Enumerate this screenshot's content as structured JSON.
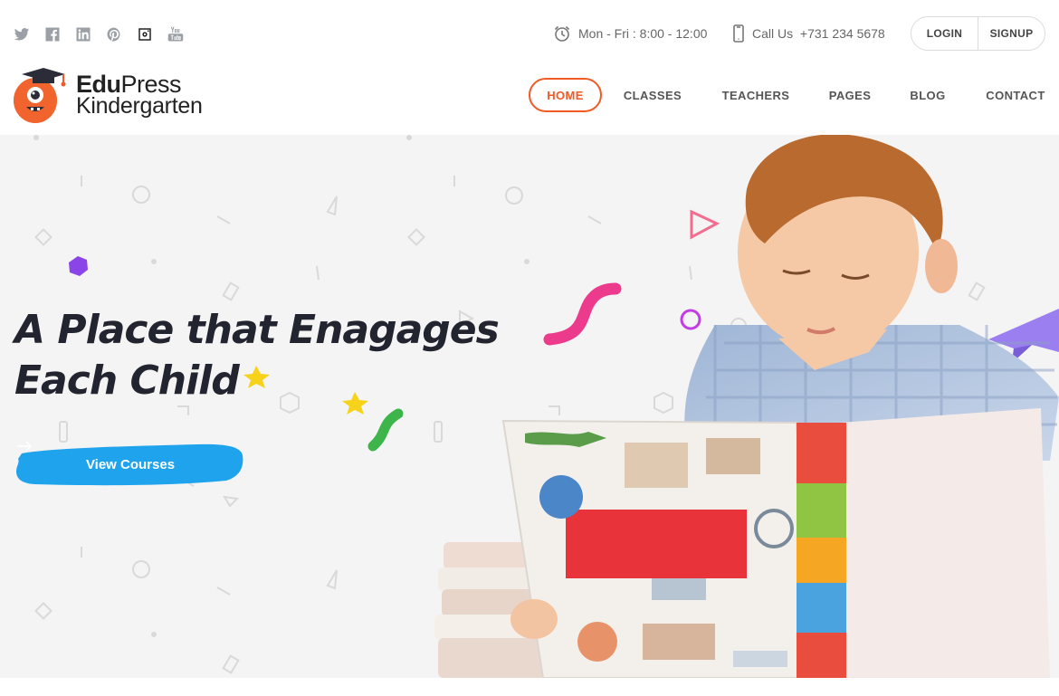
{
  "topbar": {
    "social": [
      {
        "name": "twitter-icon"
      },
      {
        "name": "facebook-icon"
      },
      {
        "name": "linkedin-icon"
      },
      {
        "name": "pinterest-icon"
      },
      {
        "name": "instagram-icon"
      },
      {
        "name": "youtube-icon"
      }
    ],
    "hours": "Mon - Fri : 8:00 - 12:00",
    "phone": "Call Us  +731 234 5678",
    "login_label": "LOGIN",
    "signup_label": "SIGNUP"
  },
  "logo": {
    "brand_bold": "Edu",
    "brand_regular": "Press",
    "subtitle": "Kindergarten"
  },
  "nav": {
    "items": [
      {
        "label": "HOME",
        "active": true
      },
      {
        "label": "CLASSES"
      },
      {
        "label": "TEACHERS"
      },
      {
        "label": "PAGES"
      },
      {
        "label": "BLOG"
      },
      {
        "label": "CONTACT"
      }
    ]
  },
  "hero": {
    "headline_line1": "A Place that Enagages",
    "headline_line2": "Each Child",
    "cta_label": "View Courses",
    "cta_icon": "arrow-right-icon"
  },
  "colors": {
    "accent": "#f15a24",
    "cta_blue": "#1ea3ec",
    "headline": "#22252f",
    "pink": "#ec3a8c",
    "green": "#3db54a",
    "purple": "#8b5cf6",
    "yellow": "#f7d21b"
  }
}
